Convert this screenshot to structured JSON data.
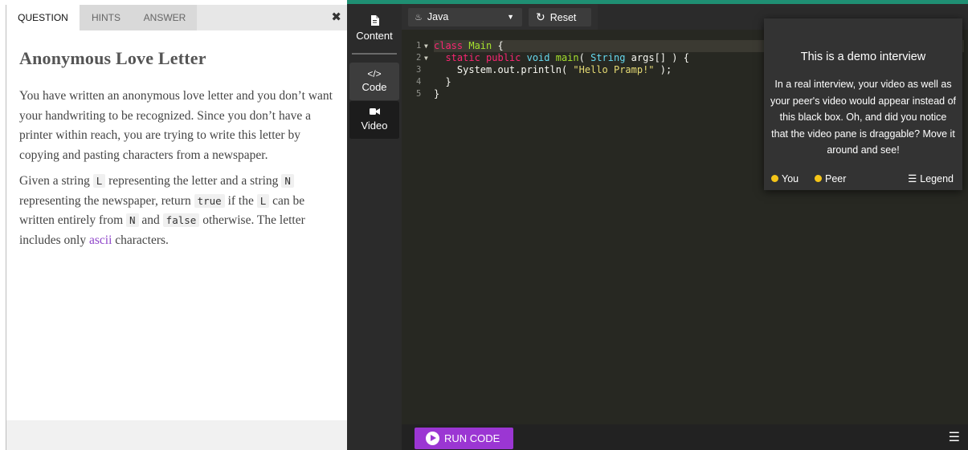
{
  "question_panel": {
    "tabs": [
      {
        "label": "QUESTION",
        "active": true
      },
      {
        "label": "HINTS",
        "active": false
      },
      {
        "label": "ANSWER",
        "active": false
      }
    ],
    "close_icon": "close-icon",
    "title": "Anonymous Love Letter",
    "paragraph1": "You have written an anonymous love letter and you don’t want your handwriting to be recognized. Since you don’t have a printer within reach, you are trying to write this letter by copying and pasting characters from a newspaper.",
    "paragraph2": {
      "t1": "Given a string ",
      "c1": "L",
      "t2": " representing the letter and a string ",
      "c2": "N",
      "t3": " representing the newspaper, return ",
      "c3": "true",
      "t4": " if the ",
      "c4": "L",
      "t5": " can be written entirely from ",
      "c5": "N",
      "t6": " and ",
      "c6": "false",
      "t7": " otherwise. The letter includes only ",
      "link": "ascii",
      "t8": " characters."
    }
  },
  "sidebar": {
    "items": [
      {
        "label": "Content",
        "icon": "document-icon"
      },
      {
        "label": "Code",
        "icon": "code-icon"
      },
      {
        "label": "Video",
        "icon": "video-camera-icon"
      }
    ]
  },
  "editor": {
    "language": "Java",
    "reset_label": "Reset",
    "line_numbers": [
      "1",
      "2",
      "3",
      "4",
      "5"
    ],
    "run_label": "RUN CODE",
    "colors": {
      "background": "#272822",
      "keyword": "#f92672",
      "class_name": "#a6e22e",
      "type": "#66d9ef",
      "string": "#e6db74",
      "run_button": "#9b36d3"
    }
  },
  "demo_overlay": {
    "title": "This is a demo interview",
    "text": "In a real interview, your video as well as your peer's video would appear instead of this black box. Oh, and did you notice that the video pane is draggable? Move it around and see!",
    "legend_you": "You",
    "legend_peer": "Peer",
    "legend_label": "Legend",
    "dot_color": "#f5c518"
  }
}
